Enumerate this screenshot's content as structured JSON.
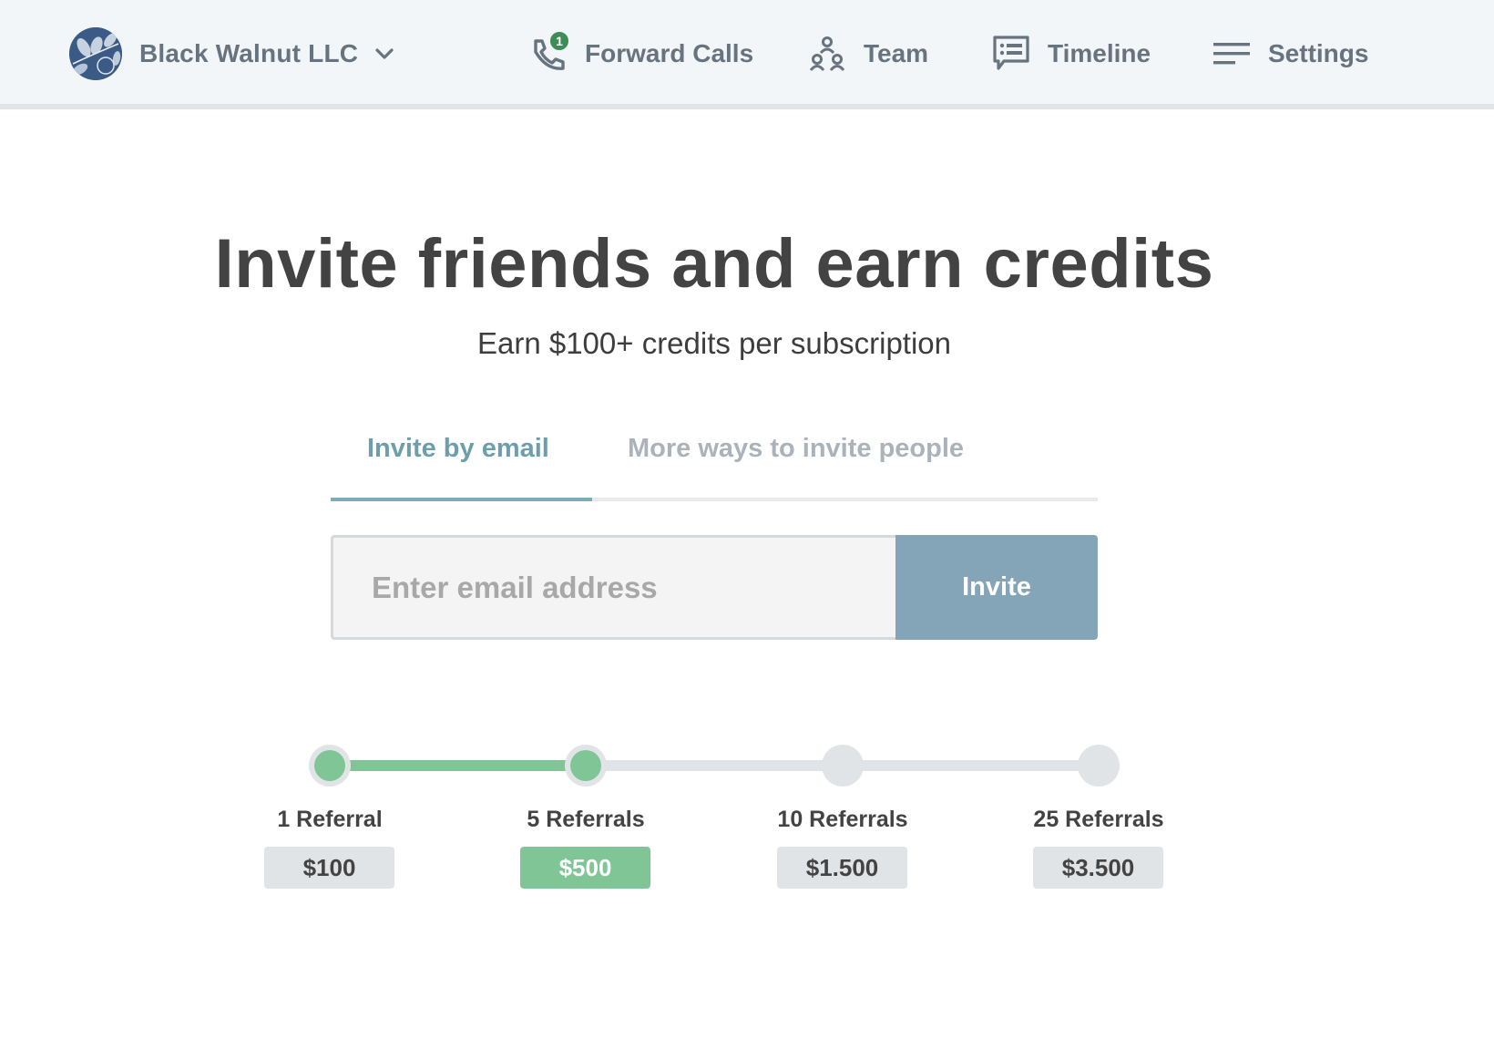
{
  "header": {
    "company_name": "Black Walnut LLC",
    "logo_icon": "walnut-leaf-logo",
    "nav": [
      {
        "label": "Forward Calls",
        "icon": "phone-forward-icon",
        "badge": "1"
      },
      {
        "label": "Team",
        "icon": "team-icon"
      },
      {
        "label": "Timeline",
        "icon": "chat-list-icon"
      },
      {
        "label": "Settings",
        "icon": "menu-lines-icon"
      }
    ]
  },
  "main": {
    "title": "Invite friends and earn credits",
    "subtitle": "Earn $100+ credits per subscription",
    "tabs": [
      {
        "label": "Invite by email",
        "active": true
      },
      {
        "label": "More ways to invite people",
        "active": false
      }
    ],
    "email_input": {
      "value": "",
      "placeholder": "Enter email address"
    },
    "invite_button": "Invite"
  },
  "referral_progress": {
    "completed_steps": 2,
    "colors": {
      "done": "#80c596",
      "pending": "#e1e4e7",
      "accent": "#7aaeb9",
      "button": "#84a4b7",
      "badge": "#3e8d57"
    },
    "steps": [
      {
        "label": "1 Referral",
        "reward": "$100",
        "reached": true,
        "highlight": false
      },
      {
        "label": "5 Referrals",
        "reward": "$500",
        "reached": true,
        "highlight": true
      },
      {
        "label": "10 Referrals",
        "reward": "$1.500",
        "reached": false,
        "highlight": false
      },
      {
        "label": "25 Referrals",
        "reward": "$3.500",
        "reached": false,
        "highlight": false
      }
    ]
  }
}
